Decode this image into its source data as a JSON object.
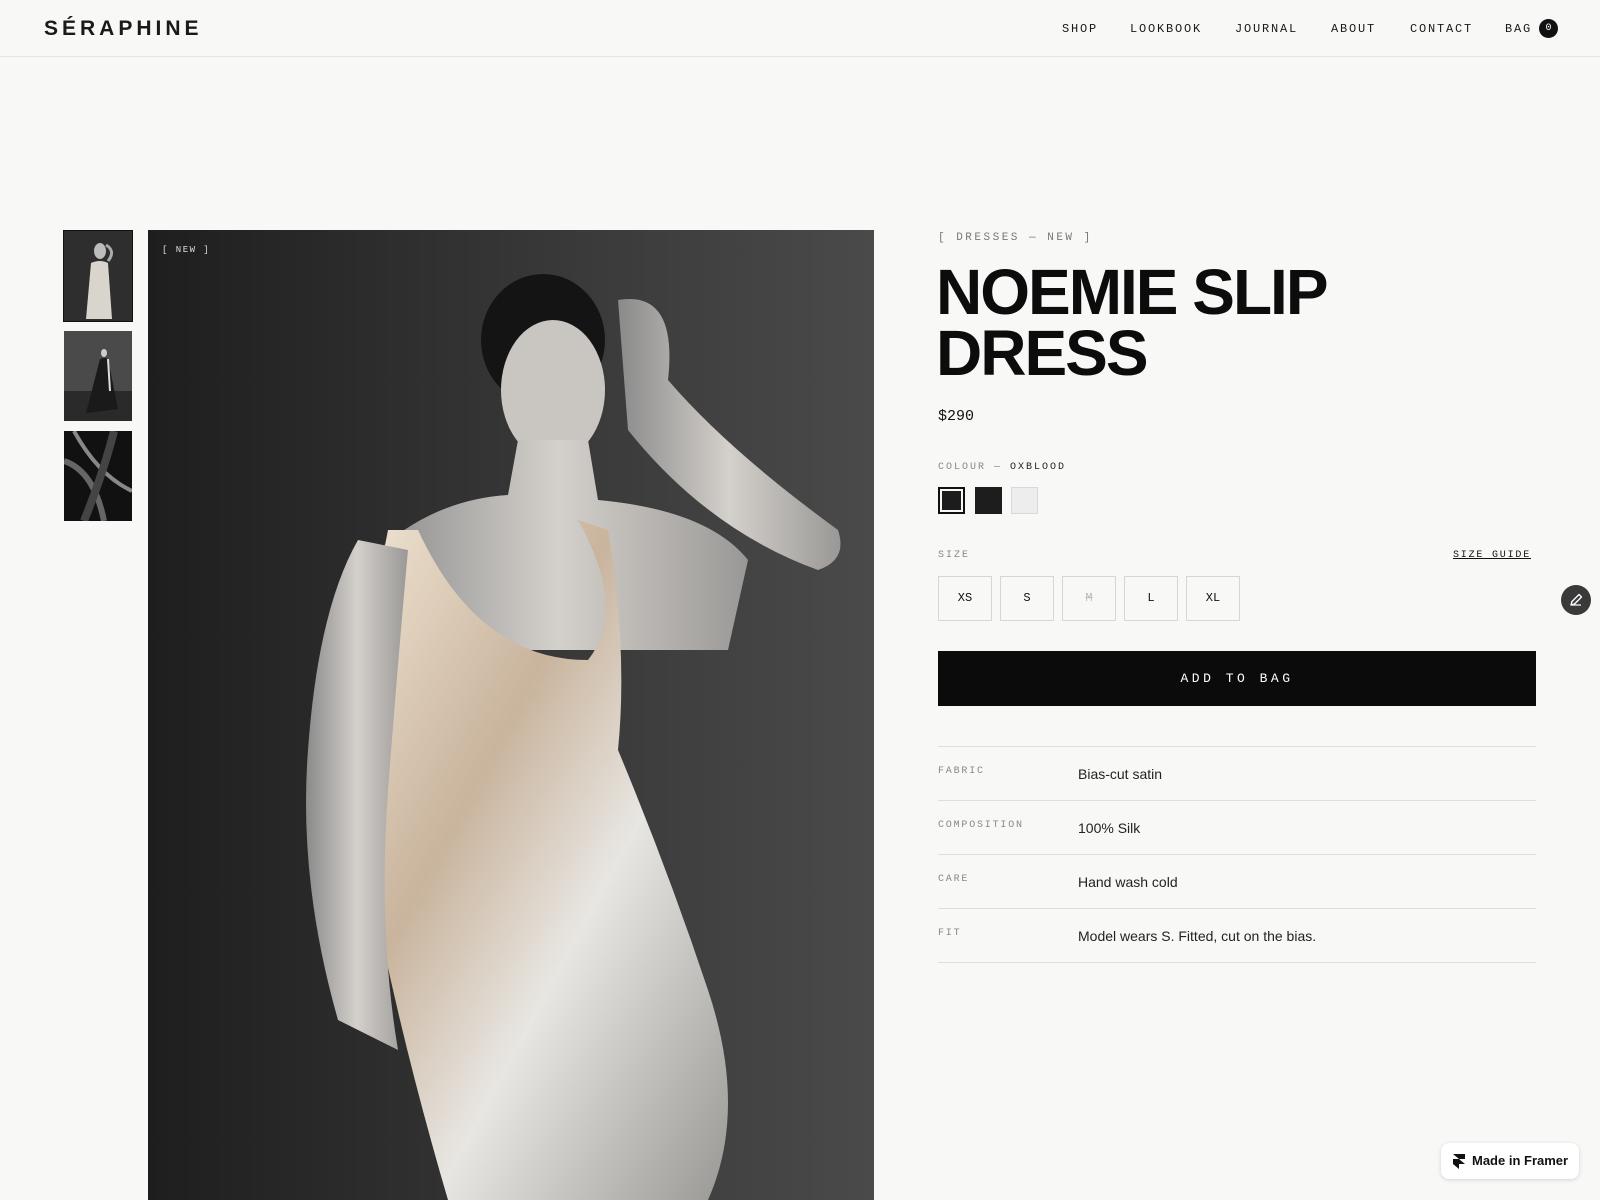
{
  "brand": {
    "logo": "SÉRAPHINE"
  },
  "nav": {
    "items": [
      "SHOP",
      "LOOKBOOK",
      "JOURNAL",
      "ABOUT",
      "CONTACT"
    ],
    "bag_label": "BAG",
    "bag_count": "0"
  },
  "gallery": {
    "badge": "[ NEW ]",
    "thumbnails": [
      "thumbnail-1",
      "thumbnail-2",
      "thumbnail-3"
    ],
    "active_thumbnail": 0
  },
  "product": {
    "breadcrumb": "[ DRESSES — NEW ]",
    "title_line1": "NOEMIE SLIP",
    "title_line2": "DRESS",
    "price": "$290",
    "colour_label": "COLOUR —",
    "colour_value": "OXBLOOD",
    "swatches": [
      "#1c1c1c",
      "#1d1d1d",
      "#ededed"
    ],
    "size_label": "SIZE",
    "size_guide": "SIZE GUIDE",
    "sizes": [
      {
        "label": "XS",
        "available": true
      },
      {
        "label": "S",
        "available": true
      },
      {
        "label": "M",
        "available": false
      },
      {
        "label": "L",
        "available": true
      },
      {
        "label": "XL",
        "available": true
      }
    ],
    "add_to_bag": "ADD TO BAG",
    "specs": [
      {
        "key": "FABRIC",
        "value": "Bias-cut satin"
      },
      {
        "key": "COMPOSITION",
        "value": "100% Silk"
      },
      {
        "key": "CARE",
        "value": "Hand wash cold"
      },
      {
        "key": "FIT",
        "value": "Model wears S. Fitted, cut on the bias."
      }
    ]
  },
  "badges": {
    "framer": "Made in Framer"
  }
}
